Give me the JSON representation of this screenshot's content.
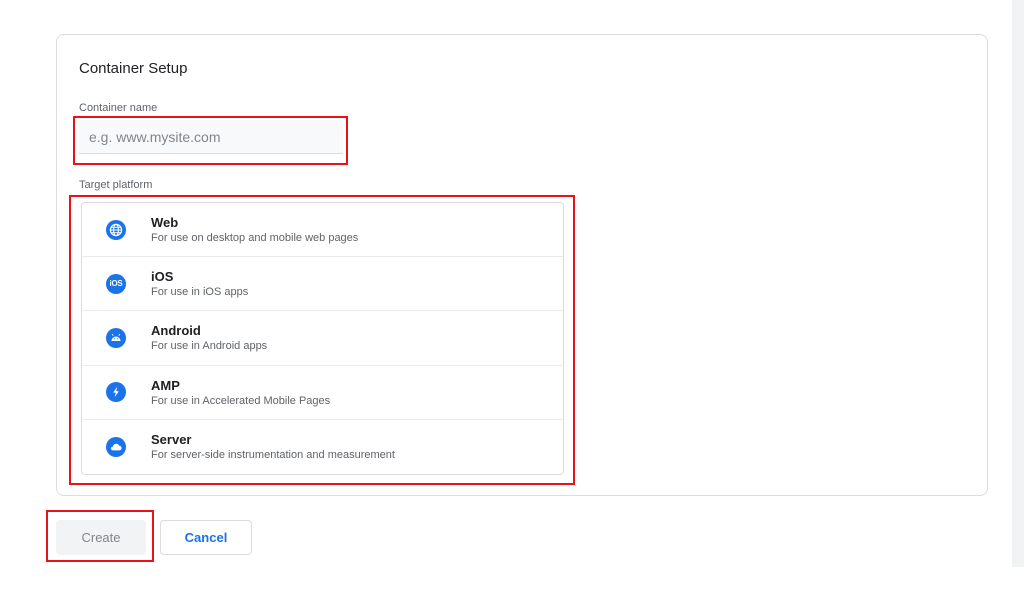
{
  "card": {
    "title": "Container Setup",
    "name_label": "Container name",
    "name_placeholder": "e.g. www.mysite.com",
    "name_value": "",
    "platform_label": "Target platform"
  },
  "platforms": [
    {
      "name": "Web",
      "description": "For use on desktop and mobile web pages",
      "icon": "globe-icon"
    },
    {
      "name": "iOS",
      "description": "For use in iOS apps",
      "icon": "ios-icon",
      "icon_text": "iOS"
    },
    {
      "name": "Android",
      "description": "For use in Android apps",
      "icon": "android-icon"
    },
    {
      "name": "AMP",
      "description": "For use in Accelerated Mobile Pages",
      "icon": "lightning-icon"
    },
    {
      "name": "Server",
      "description": "For server-side instrumentation and measurement",
      "icon": "cloud-icon"
    }
  ],
  "actions": {
    "create_label": "Create",
    "cancel_label": "Cancel"
  },
  "colors": {
    "accent": "#1a73e8",
    "highlight": "#e8121a",
    "disabled_bg": "#f1f3f4"
  }
}
